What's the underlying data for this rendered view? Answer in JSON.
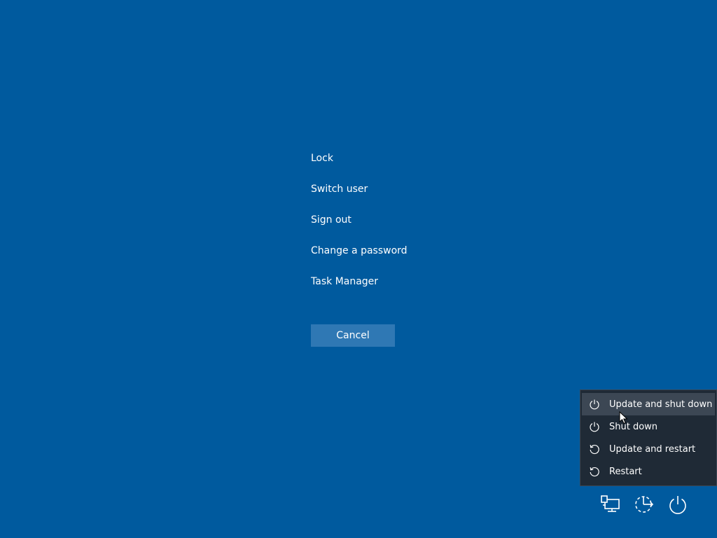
{
  "colors": {
    "background": "#005a9e",
    "cancel_button": "#2f78b4",
    "power_menu_background": "#1f2a36",
    "power_menu_hover": "#3c4754"
  },
  "security_options": {
    "items": [
      {
        "label": "Lock"
      },
      {
        "label": "Switch user"
      },
      {
        "label": "Sign out"
      },
      {
        "label": "Change a password"
      },
      {
        "label": "Task Manager"
      }
    ],
    "cancel_label": "Cancel"
  },
  "power_menu": {
    "items": [
      {
        "label": "Update and shut down",
        "icon": "power-icon",
        "hovered": true
      },
      {
        "label": "Shut down",
        "icon": "power-icon",
        "hovered": false
      },
      {
        "label": "Update and restart",
        "icon": "restart-icon",
        "hovered": false
      },
      {
        "label": "Restart",
        "icon": "restart-icon",
        "hovered": false
      }
    ]
  },
  "tray": {
    "buttons": [
      {
        "icon": "network-icon"
      },
      {
        "icon": "accessibility-icon"
      },
      {
        "icon": "power-icon"
      }
    ]
  }
}
